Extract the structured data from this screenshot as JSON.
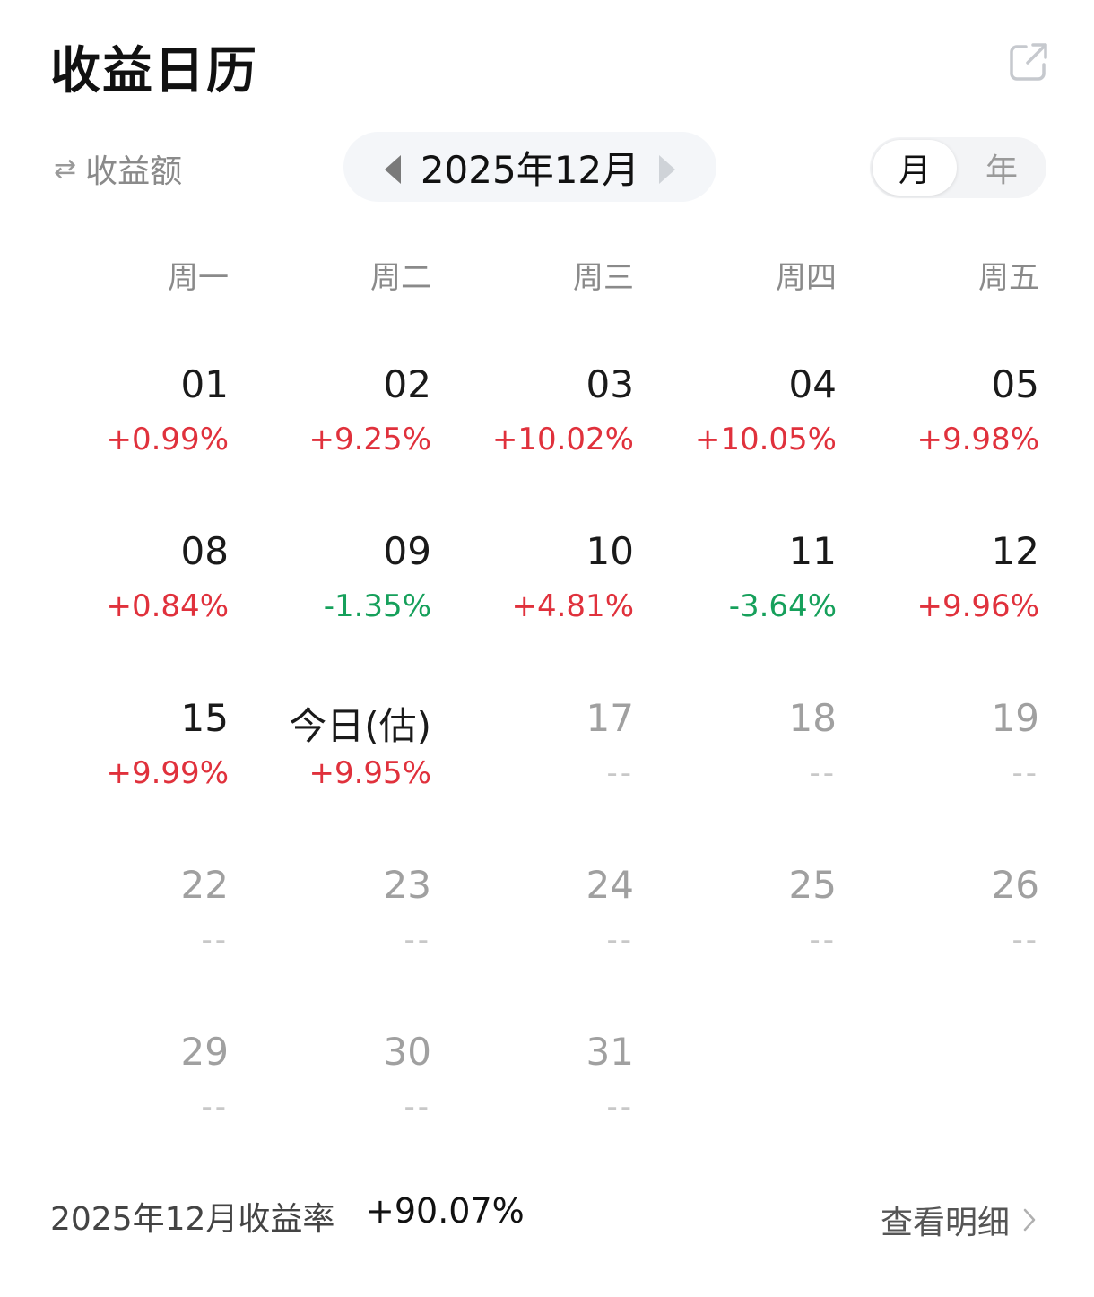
{
  "header": {
    "title": "收益日历",
    "share_icon": "external-link-icon"
  },
  "controls": {
    "metric_toggle": {
      "icon": "swap-arrows-icon",
      "label": "收益额"
    },
    "month_nav": {
      "label": "2025年12月"
    },
    "segment": {
      "month_label": "月",
      "year_label": "年",
      "selected": "month"
    }
  },
  "weekdays": [
    "周一",
    "周二",
    "周三",
    "周四",
    "周五"
  ],
  "calendar": {
    "rows": [
      [
        {
          "day": "01",
          "value": "+0.99%"
        },
        {
          "day": "02",
          "value": "+9.25%"
        },
        {
          "day": "03",
          "value": "+10.02%"
        },
        {
          "day": "04",
          "value": "+10.05%"
        },
        {
          "day": "05",
          "value": "+9.98%"
        }
      ],
      [
        {
          "day": "08",
          "value": "+0.84%"
        },
        {
          "day": "09",
          "value": "-1.35%"
        },
        {
          "day": "10",
          "value": "+4.81%"
        },
        {
          "day": "11",
          "value": "-3.64%"
        },
        {
          "day": "12",
          "value": "+9.96%"
        }
      ],
      [
        {
          "day": "15",
          "value": "+9.99%"
        },
        {
          "day": "今日(估)",
          "value": "+9.95%"
        },
        {
          "day": "17",
          "value": "--"
        },
        {
          "day": "18",
          "value": "--"
        },
        {
          "day": "19",
          "value": "--"
        }
      ],
      [
        {
          "day": "22",
          "value": "--"
        },
        {
          "day": "23",
          "value": "--"
        },
        {
          "day": "24",
          "value": "--"
        },
        {
          "day": "25",
          "value": "--"
        },
        {
          "day": "26",
          "value": "--"
        }
      ],
      [
        {
          "day": "29",
          "value": "--"
        },
        {
          "day": "30",
          "value": "--"
        },
        {
          "day": "31",
          "value": "--"
        }
      ]
    ]
  },
  "footer": {
    "label": "2025年12月收益率",
    "value": "+90.07%",
    "link_label": "查看明细"
  },
  "colors": {
    "positive": "#e0313c",
    "negative": "#16a05b",
    "empty": "#c8c8c8"
  }
}
